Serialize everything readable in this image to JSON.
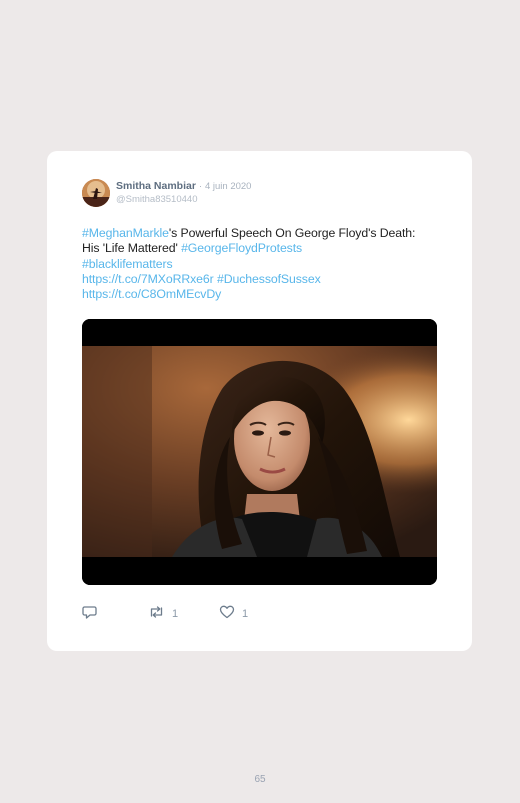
{
  "tweet": {
    "author_name": "Smitha Nambiar",
    "separator": "·",
    "date": "4 juin 2020",
    "handle": "@Smitha83510440",
    "text_parts": [
      {
        "text": "#MeghanMarkle",
        "link": true
      },
      {
        "text": "'s Powerful Speech On George Floyd's Death: His 'Life Mattered' ",
        "link": false
      },
      {
        "text": "#GeorgeFloydProtests",
        "link": true
      },
      {
        "text": "#blacklifematters",
        "link": true
      },
      {
        "text": "https://t.co/7MXoRRxe6r",
        "link": true
      },
      {
        "text": "#DuchessofSussex",
        "link": true
      },
      {
        "text": "https://t.co/C8OmMEcvDy",
        "link": true
      }
    ],
    "actions": {
      "reply_icon": "reply-icon",
      "retweet_icon": "retweet-icon",
      "retweet_count": "1",
      "like_icon": "heart-icon",
      "like_count": "1"
    }
  },
  "page_number": "65",
  "colors": {
    "link": "#58b6ea",
    "background": "#ede9e9",
    "card": "#ffffff"
  }
}
